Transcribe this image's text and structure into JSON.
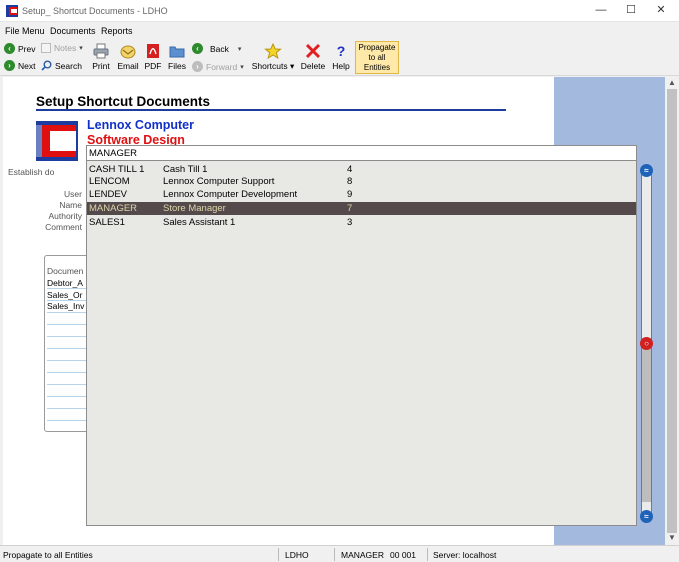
{
  "window": {
    "title": "Setup_ Shortcut Documents - LDHO",
    "minimize": "—",
    "maximize": "☐",
    "close": "✕"
  },
  "menu": [
    "File Menu",
    "Documents",
    "Reports"
  ],
  "toolbar": {
    "prev": "Prev",
    "notes": "Notes",
    "next": "Next",
    "search": "Search",
    "print": "Print",
    "email": "Email",
    "pdf": "PDF",
    "files": "Files",
    "back": "Back",
    "forward": "Forward",
    "shortcuts": "Shortcuts",
    "delete": "Delete",
    "help": "Help",
    "propagate_line1": "Propagate",
    "propagate_line2": "to all",
    "propagate_line3": "Entities"
  },
  "page": {
    "title": "Setup Shortcut Documents",
    "company_name": "Lennox Computer",
    "company_sub": "Software Design",
    "establish_label": "Establish do",
    "user_label": "User",
    "name_label": "Name",
    "authority_label": "Authority",
    "comment_label": "Comment"
  },
  "documents": {
    "header": "Documen",
    "rows": [
      "Debtor_A",
      "Sales_Or",
      "Sales_Inv"
    ]
  },
  "dropdown": {
    "input_value": "MANAGER",
    "rows": [
      {
        "code": "CASH TILL 1",
        "name": "Cash Till 1",
        "level": "4",
        "selected": false
      },
      {
        "code": "LENCOM",
        "name": "Lennox Computer Support",
        "level": "8",
        "selected": false
      },
      {
        "code": "LENDEV",
        "name": "Lennox Computer Development",
        "level": "9",
        "selected": false
      },
      {
        "code": "MANAGER",
        "name": "Store Manager",
        "level": "7",
        "selected": true
      },
      {
        "code": "SALES1",
        "name": "Sales Assistant 1",
        "level": "3",
        "selected": false
      }
    ]
  },
  "status": {
    "message": "Propagate to all Entities",
    "entity": "LDHO",
    "user": "MANAGER",
    "code": "00 001",
    "server": "Server: localhost"
  },
  "colors": {
    "accent": "#1c3ca0",
    "company_blue": "#1230c8",
    "company_red": "#e01010",
    "selection": "#554a4b",
    "side_panel": "#a3b9de"
  }
}
